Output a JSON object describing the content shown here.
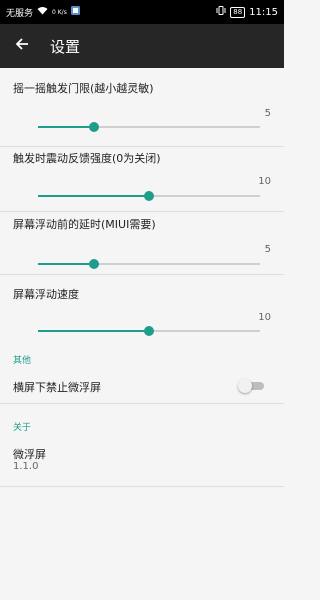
{
  "status_bar": {
    "carrier": "无服务",
    "speed": "0 K/s",
    "battery": "88",
    "time": "11:15"
  },
  "appbar": {
    "title": "设置"
  },
  "settings": {
    "sliders": [
      {
        "label": "摇一摇触发门限(越小越灵敏)",
        "value": "5",
        "fraction": 0.25
      },
      {
        "label": "触发时震动反馈强度(0为关闭)",
        "value": "10",
        "fraction": 0.5
      },
      {
        "label": "屏幕浮动前的延时(MIUI需要)",
        "value": "5",
        "fraction": 0.25
      },
      {
        "label": "屏幕浮动速度",
        "value": "10",
        "fraction": 0.5
      }
    ],
    "section_other": "其他",
    "landscape_toggle": {
      "label": "横屏下禁止微浮屏",
      "state": "off"
    },
    "section_about": "关于",
    "app_name": "微浮屏",
    "app_version": "1.1.0"
  },
  "colors": {
    "accent": "#1e9d8a",
    "appbar": "#262626",
    "background": "#f5f5f5"
  }
}
